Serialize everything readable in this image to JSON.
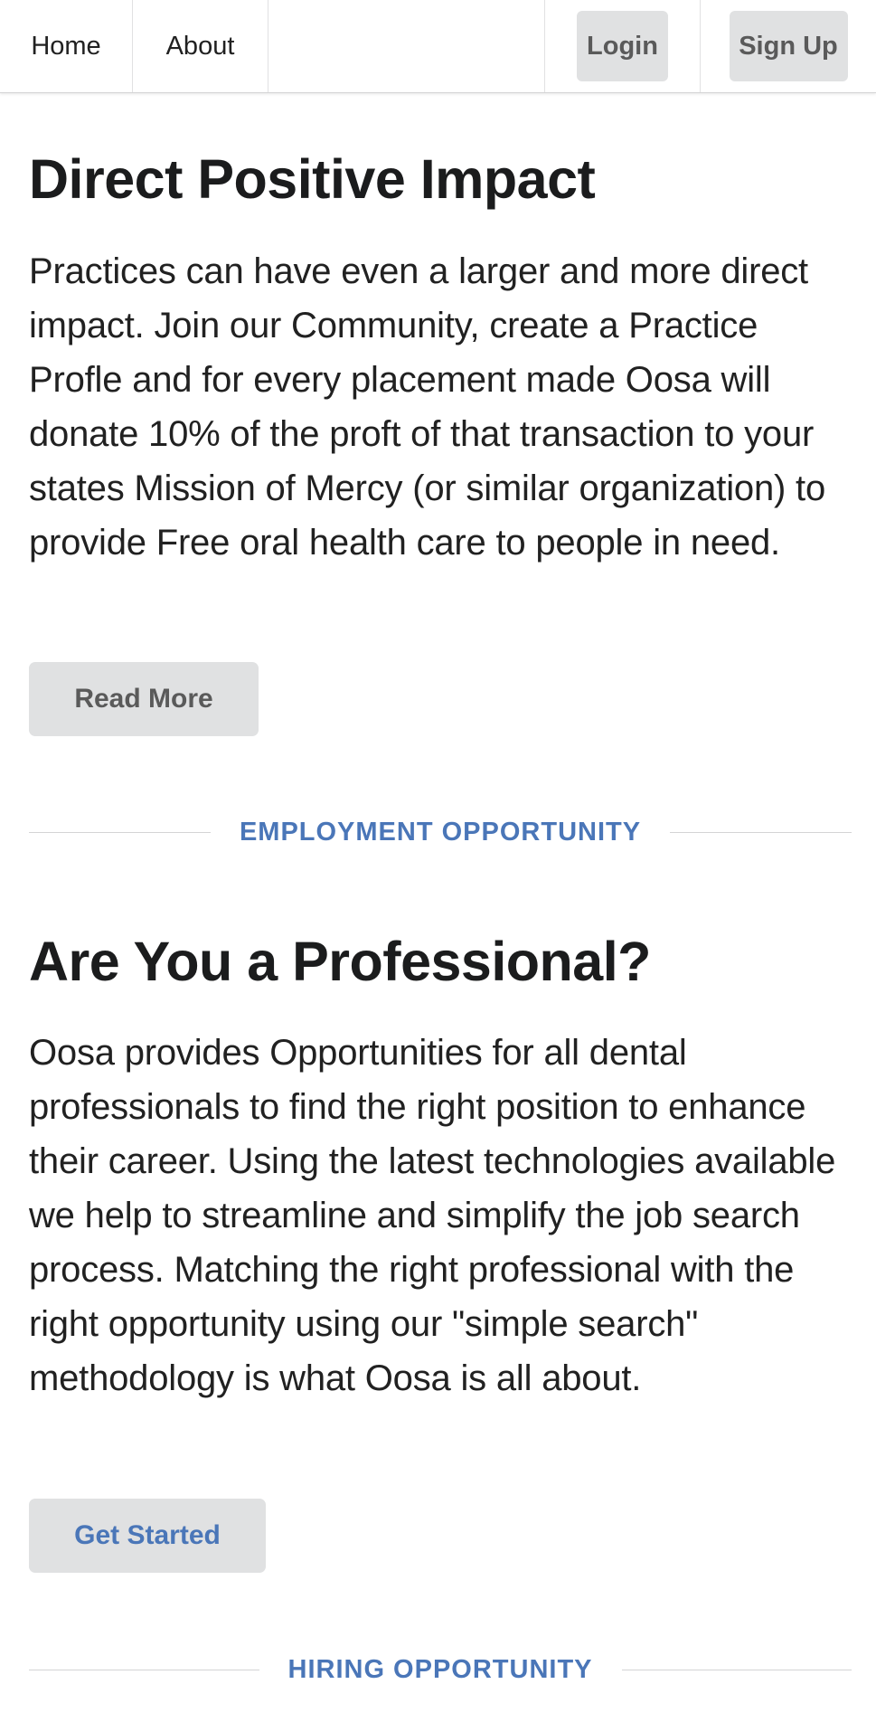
{
  "nav": {
    "home": "Home",
    "about": "About",
    "login": "Login",
    "signup": "Sign Up"
  },
  "impact": {
    "title": "Direct Positive Impact",
    "body": "Practices can have even a larger and more direct impact. Join our Community, create a Practice Profle and for every placement made Oosa will donate 10% of the proft of that transaction to your states Mission of Mercy (or similar organization) to provide Free oral health care to people in need.",
    "button": "Read More"
  },
  "employment_divider": "EMPLOYMENT OPPORTUNITY",
  "professional": {
    "title": "Are You a Professional?",
    "body": "Oosa provides Opportunities for all dental professionals to find the right position to enhance their career. Using the latest technologies available we help to streamline and simplify the job search process. Matching the right professional with the right opportunity using our \"simple search\" methodology is what Oosa is all about.",
    "button": "Get Started"
  },
  "hiring_divider": "HIRING OPPORTUNITY",
  "colors": {
    "accent": "#4a76b8",
    "button_bg": "#e0e1e2",
    "text": "#212121"
  }
}
